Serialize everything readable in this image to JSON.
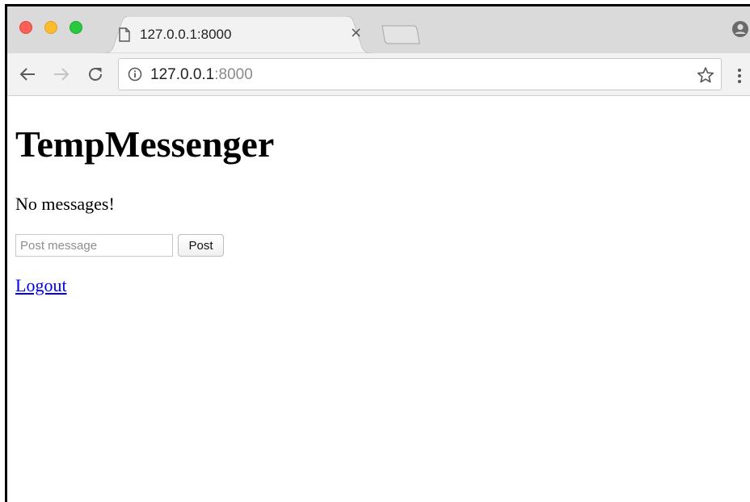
{
  "window": {
    "traffic_lights": {
      "close": "#fc5f57",
      "minimize": "#fdbc2e",
      "maximize": "#29c840"
    }
  },
  "tab": {
    "title": "127.0.0.1:8000",
    "icon": "page-icon",
    "close_glyph": "×"
  },
  "toolbar": {
    "back_icon": "back-arrow-icon",
    "forward_icon": "forward-arrow-icon",
    "reload_icon": "reload-icon",
    "url_host": "127.0.0.1",
    "url_port": ":8000",
    "info_icon": "info-icon",
    "bookmark_icon": "star-icon",
    "menu_icon": "kebab-menu-icon"
  },
  "page": {
    "title": "TempMessenger",
    "empty_text": "No messages!",
    "message_input": {
      "value": "",
      "placeholder": "Post message"
    },
    "post_button_label": "Post",
    "logout_link_text": "Logout",
    "link_color": "#0000ee"
  }
}
